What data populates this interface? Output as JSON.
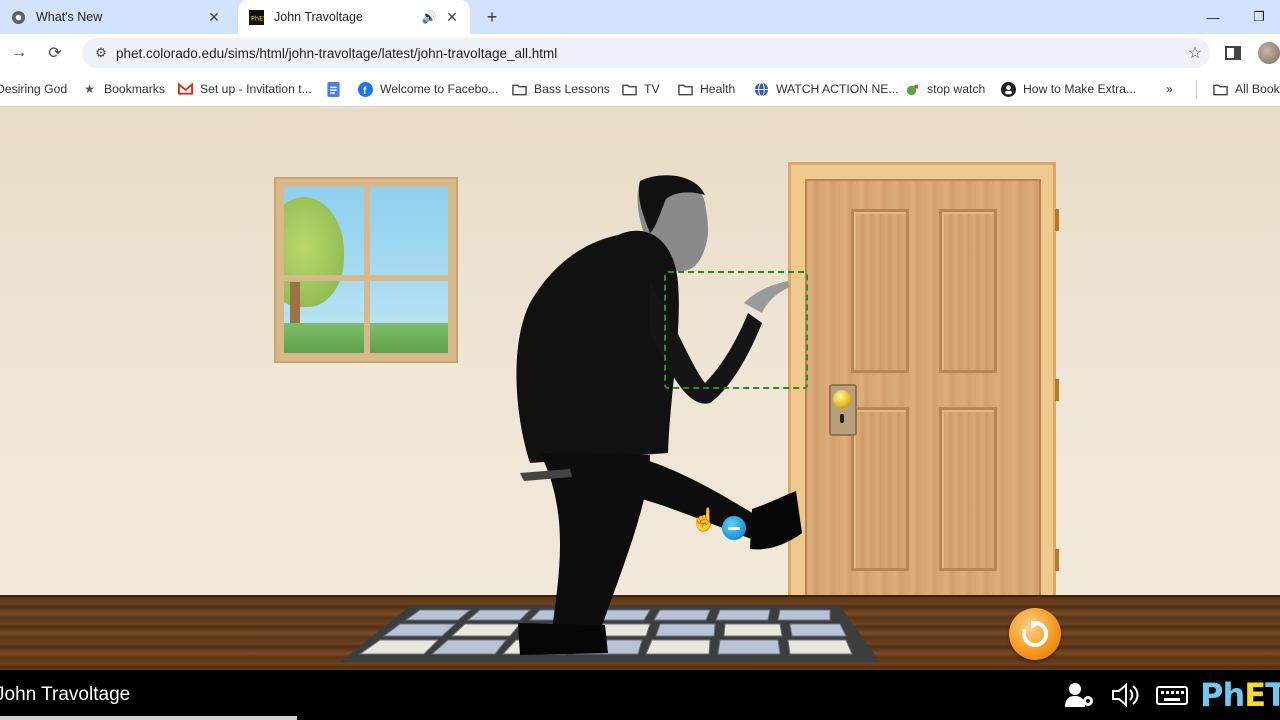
{
  "browser": {
    "tabs": [
      {
        "title": "What's New",
        "favicon": "chrome-icon",
        "active": false
      },
      {
        "title": "John Travoltage",
        "favicon": "phet-icon",
        "active": true
      }
    ],
    "url": "phet.colorado.edu/sims/html/john-travoltage/latest/john-travoltage_all.html",
    "bookmarks": [
      {
        "label": "Desiring God",
        "icon": "none"
      },
      {
        "label": "Bookmarks",
        "icon": "star-icon"
      },
      {
        "label": "Set up - Invitation t...",
        "icon": "gmail-icon"
      },
      {
        "label": "",
        "icon": "docs-icon"
      },
      {
        "label": "Welcome to Facebo...",
        "icon": "facebook-icon"
      },
      {
        "label": "Bass Lessons",
        "icon": "folder-icon"
      },
      {
        "label": "TV",
        "icon": "folder-icon"
      },
      {
        "label": "Health",
        "icon": "folder-icon"
      },
      {
        "label": "WATCH ACTION NE...",
        "icon": "globe-icon"
      },
      {
        "label": "stop watch",
        "icon": "stopwatch-icon"
      },
      {
        "label": "How to Make Extra...",
        "icon": "person-icon"
      },
      {
        "label": "All Book",
        "icon": "folder-icon"
      }
    ]
  },
  "sim": {
    "title": "John Travoltage",
    "logo": "PhET"
  },
  "colors": {
    "accent_blue": "#1a92d6",
    "reset_orange": "#f79a1e",
    "dash_green": "#2c8a23",
    "nav_bg": "#000000"
  }
}
